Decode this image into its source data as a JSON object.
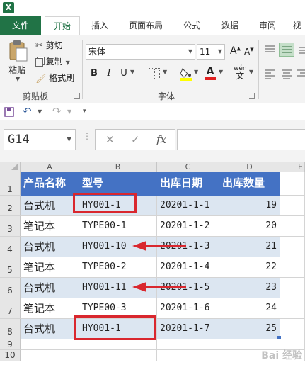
{
  "app": {
    "logo_letter": "X"
  },
  "ribbon_tabs": [
    {
      "label": "文件",
      "kind": "file"
    },
    {
      "label": "开始",
      "kind": "active"
    },
    {
      "label": "插入"
    },
    {
      "label": "页面布局"
    },
    {
      "label": "公式"
    },
    {
      "label": "数据"
    },
    {
      "label": "审阅"
    },
    {
      "label": "视"
    }
  ],
  "clipboard": {
    "paste_label": "粘贴",
    "cut_label": "剪切",
    "copy_label": "复制",
    "format_painter_label": "格式刷",
    "group_label": "剪贴板"
  },
  "font": {
    "font_name": "宋体",
    "font_size": "11",
    "group_label": "字体",
    "bold": "B",
    "italic": "I",
    "underline": "U",
    "grow": "A",
    "shrink": "A",
    "font_color": "A",
    "phonetic": "wén"
  },
  "formula_bar": {
    "name_box": "G14",
    "fx_label": "fx",
    "cancel": "✕",
    "enter": "✓"
  },
  "columns": [
    "A",
    "B",
    "C",
    "D",
    "E"
  ],
  "rows": [
    "1",
    "2",
    "3",
    "4",
    "5",
    "6",
    "7",
    "8",
    "9",
    "10"
  ],
  "table": {
    "headers": [
      "产品名称",
      "型号",
      "出库日期",
      "出库数量"
    ],
    "rows": [
      [
        "台式机",
        "HY001-1",
        "20201-1-1",
        "19"
      ],
      [
        "笔记本",
        "TYPE00-1",
        "20201-1-2",
        "20"
      ],
      [
        "台式机",
        "HY001-10",
        "20201-1-3",
        "21"
      ],
      [
        "笔记本",
        "TYPE00-2",
        "20201-1-4",
        "22"
      ],
      [
        "台式机",
        "HY001-11",
        "20201-1-5",
        "23"
      ],
      [
        "笔记本",
        "TYPE00-3",
        "20201-1-6",
        "24"
      ],
      [
        "台式机",
        "HY001-1",
        "20201-1-7",
        "25"
      ]
    ]
  },
  "colors": {
    "excel_green": "#217346",
    "header_blue": "#4472c4",
    "band_blue": "#dce6f1",
    "annotation_red": "#d9272e"
  },
  "watermark": "Bai 经验"
}
